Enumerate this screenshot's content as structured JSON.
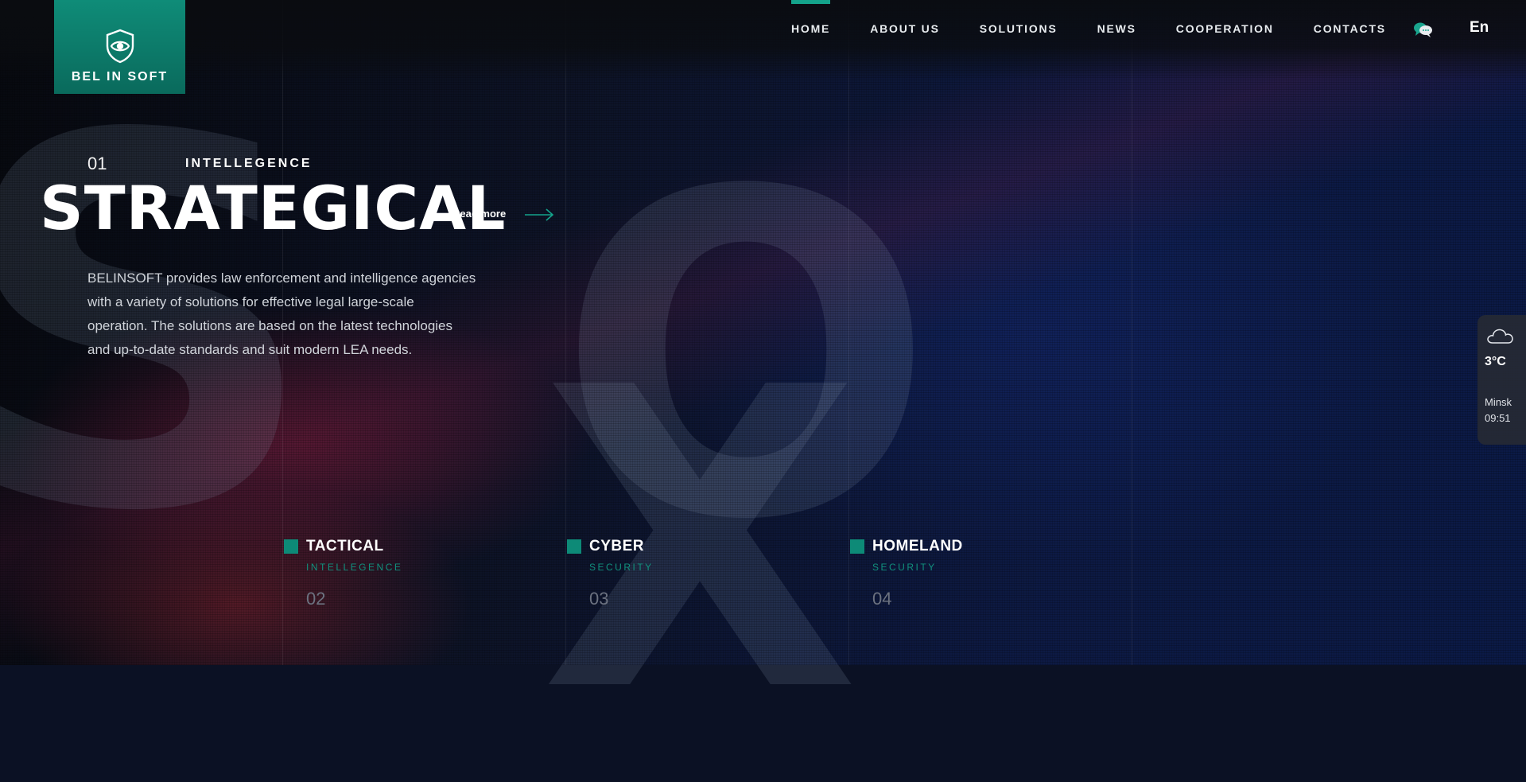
{
  "brand": {
    "logo_text": "BEL IN SOFT",
    "accent": "#0f8c78"
  },
  "nav": {
    "items": [
      {
        "label": "HOME",
        "active": true
      },
      {
        "label": "ABOUT US",
        "active": false
      },
      {
        "label": "SOLUTIONS",
        "active": false
      },
      {
        "label": "NEWS",
        "active": false
      },
      {
        "label": "COOPERATION",
        "active": false
      },
      {
        "label": "CONTACTS",
        "active": false
      }
    ],
    "chat_icon": "chat-bubbles-icon",
    "language": "En"
  },
  "hero": {
    "number": "01",
    "category": "INTELLEGENCE",
    "title": "STRATEGICAL",
    "read_more": "Read more",
    "description": "BELINSOFT provides law enforcement and intelligence agencies with a variety of solutions for effective legal large-scale operation. The solutions are based on the latest technologies and up-to-date standards and suit modern LEA needs."
  },
  "categories": [
    {
      "title": "TACTICAL",
      "subtitle": "INTELLEGENCE",
      "number": "02"
    },
    {
      "title": "CYBER",
      "subtitle": "SECURITY",
      "number": "03"
    },
    {
      "title": "HOMELAND",
      "subtitle": "SECURITY",
      "number": "04"
    }
  ],
  "weather": {
    "icon": "cloud-icon",
    "temperature": "3°C",
    "city": "Minsk",
    "time": "09:51"
  }
}
